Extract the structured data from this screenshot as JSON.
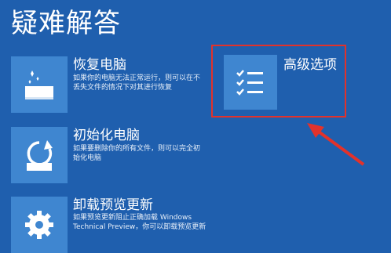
{
  "page": {
    "title": "疑难解答"
  },
  "options": [
    {
      "id": "recover",
      "title": "恢复电脑",
      "desc": "如果你的电脑无法正常运行，则可以在不丢失文件的情况下对其进行恢复",
      "icon": "restore-icon"
    },
    {
      "id": "reset",
      "title": "初始化电脑",
      "desc": "如果要删除你的所有文件，则可以完全初始化电脑",
      "icon": "refresh-icon"
    },
    {
      "id": "uninstall",
      "title": "卸载预览更新",
      "desc": "如果预览更新阻止正确加载 Windows Technical Preview，你可以卸载预览更新",
      "icon": "gear-icon"
    },
    {
      "id": "advanced",
      "title": "高级选项",
      "icon": "checklist-icon"
    }
  ],
  "annotation": {
    "color": "#e2322b"
  }
}
